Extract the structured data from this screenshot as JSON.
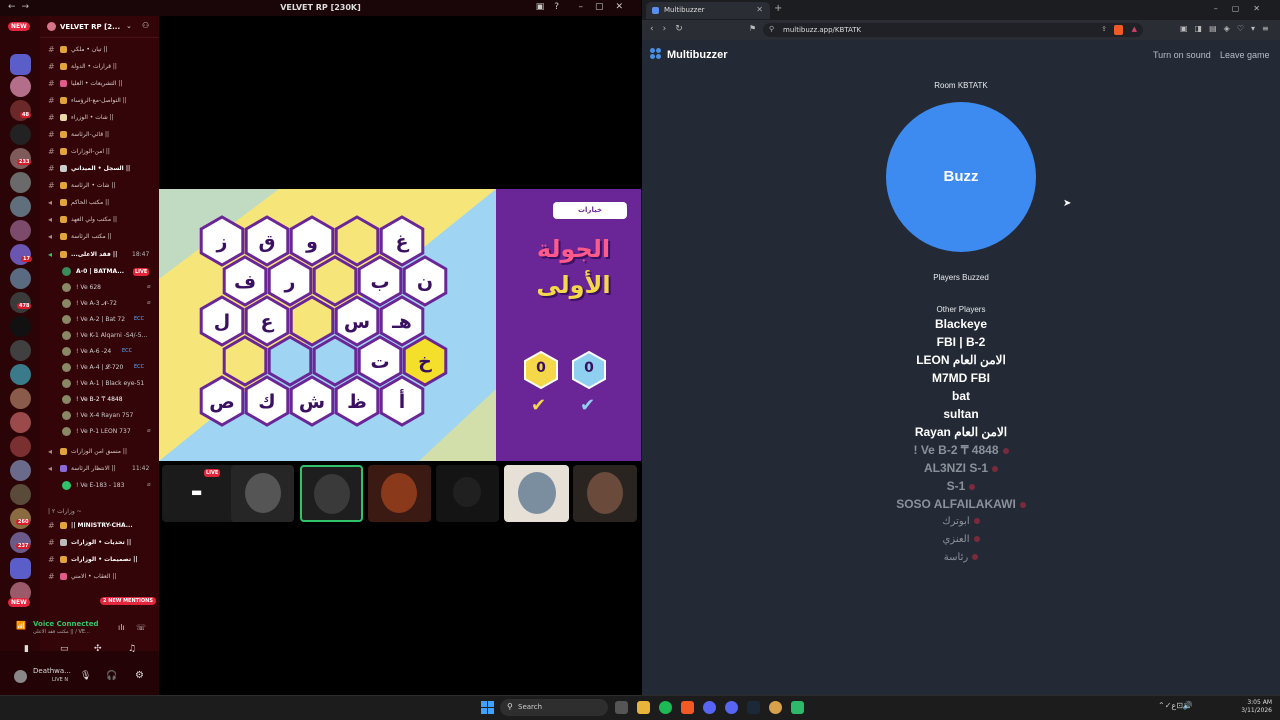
{
  "left_window": {
    "title": "VELVET RP [230K]",
    "guild_name": "VELVET RP [2...",
    "channels": [
      "تيان • ملكي ||",
      "قرارات • الدولة ||",
      "التشريعات • العليا ||",
      "التواصل-مع-الرؤساء ||",
      "شات • الوزراء ||",
      "قائي-الرئاسة ||",
      "امن-الوزارات ||",
      "السجل • الميداني ||",
      "شات • الرئاسة ||",
      "مكتب الحاكم ||",
      "مكتب ولي العهد ||",
      "مكتب الرئاسة ||"
    ],
    "voice_channel": "...فقد الاعلى ||",
    "voice_time": "18:47",
    "voice_users": [
      {
        "name": "A-0 | BATMA...",
        "tag": "LIVE"
      },
      {
        "name": "! Ve 628",
        "tag": ""
      },
      {
        "name": "! Ve A-3 𝓝-72",
        "tag": ""
      },
      {
        "name": "! Ve A-2 | Bat 72",
        "tag": "ECC"
      },
      {
        "name": "! Ve K-1 Alqarni -S4/-5...",
        "tag": ""
      },
      {
        "name": "! Ve A-6 -24",
        "tag": "ECC"
      },
      {
        "name": "! Ve A-4 | 𝓛-720",
        "tag": "ECC"
      },
      {
        "name": "! Ve A-1 | Black eye-51",
        "tag": ""
      },
      {
        "name": "! Ve B-2 ₸ 4848",
        "tag": ""
      },
      {
        "name": "! Ve X-4 Rayan 757",
        "tag": ""
      },
      {
        "name": "! Ve P-1 LEON 737",
        "tag": ""
      }
    ],
    "more_channels": [
      {
        "label": "منسق امن الوزارات ||",
        "time": ""
      },
      {
        "label": "الانتظار الرئاسة ||",
        "time": "11:42"
      },
      {
        "label": "! Ve E-183 - 183",
        "time": ""
      }
    ],
    "category": "| وزارات ٢ ~",
    "category_channels": [
      "|| MINISTRY-CHA...",
      "تحديات • الوزارات ||",
      "تصميمات • الوزارات ||",
      "العقاب • الامني ||"
    ],
    "new_badge": "NEW",
    "mentions_badge": "2 NEW MENTIONS",
    "voice_connected": "Voice Connected",
    "voice_sub": "مكتب فقد الاعلى || / VE...",
    "username": "Deathwa...",
    "user_status": "LIVE N",
    "rail_counts": [
      "48",
      "233",
      "17",
      "478",
      "260",
      "237"
    ],
    "game": {
      "title_line1": "الجولة",
      "title_line2": "الأولى",
      "top_button": "خيارات",
      "score_yellow": "0",
      "score_blue": "0",
      "letters": [
        "ز",
        "ق",
        "و",
        "",
        "غ",
        "ف",
        "ر",
        "",
        "ب",
        "ن",
        "ل",
        "ع",
        "",
        "س",
        "هـ",
        "",
        "",
        "",
        "ت",
        "خ",
        "ص",
        "ك",
        "ش",
        "ظ",
        "أ"
      ]
    },
    "tiles_live": "LIVE"
  },
  "browser": {
    "tab_title": "Multibuzzer",
    "url": "multibuzz.app/KBTATK",
    "brand": "Multibuzzer",
    "turn_on_sound": "Turn on sound",
    "leave_game": "Leave game",
    "room_label": "Room KBTATK",
    "buzz_label": "Buzz",
    "players_buzzed": "Players Buzzed",
    "other_players_title": "Other Players",
    "active_players": [
      "Blackeye",
      "FBI | B-2",
      "LEON الامن العام",
      "M7MD FBI",
      "bat",
      "sultan",
      "Rayan الامن العام"
    ],
    "inactive_players": [
      "! Ve B-2 ₸ 4848",
      "AL3NZI S-1",
      "S-1",
      "SOSO ALFAILAKAWI"
    ],
    "inactive_players_small": [
      "ابوترك",
      "العنزي",
      "رئاسة"
    ]
  },
  "taskbar": {
    "search_label": "Search",
    "time": "3:05 AM",
    "date": "3/11/2026"
  },
  "colors": {
    "buzz_blue": "#3d8bf0",
    "page_bg": "#242a35",
    "discord_red": "#330508",
    "game_purple": "#6a2596"
  }
}
